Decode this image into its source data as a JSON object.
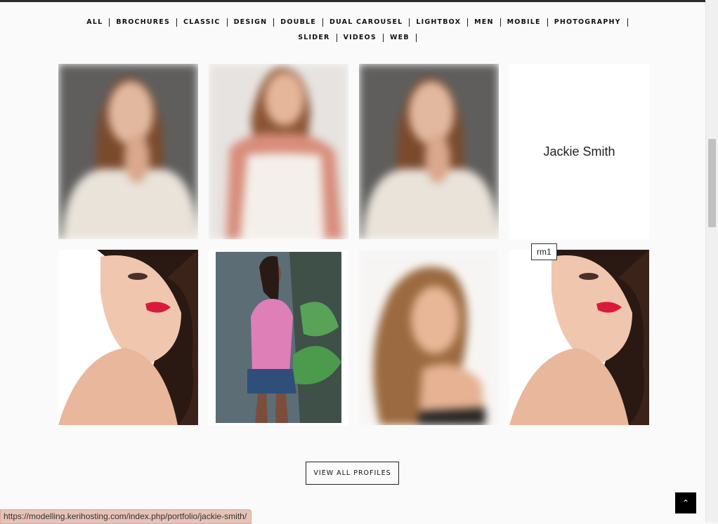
{
  "filters": [
    "ALL",
    "BROCHURES",
    "CLASSIC",
    "DESIGN",
    "DOUBLE",
    "DUAL CAROUSEL",
    "LIGHTBOX",
    "MEN",
    "MOBILE",
    "PHOTOGRAPHY",
    "SLIDER",
    "VIDEOS",
    "WEB"
  ],
  "profile_name": "Jackie Smith",
  "tooltip": "rm1",
  "view_all_label": "VIEW ALL PROFILES",
  "back_to_top_icon": "chevron-up-icon",
  "back_to_top_glyph": "⌃",
  "status_url": "https://modelling.kerihosting.com/index.php/portfolio/jackie-smith/",
  "colors": {
    "topbar": "#2b2b2b",
    "lip": "#d81b3c",
    "pink_top": "#de7fb8",
    "shorts": "#2f4f7a"
  }
}
